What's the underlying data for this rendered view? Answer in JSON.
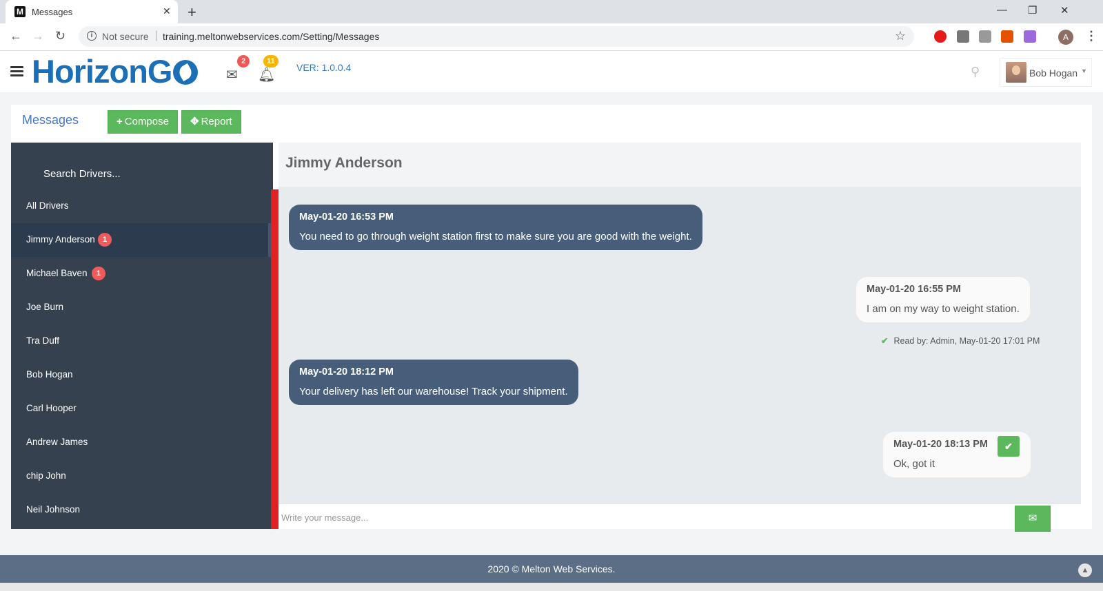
{
  "browser": {
    "tab_title": "Messages",
    "tab_favicon": "M",
    "url_security": "Not secure",
    "url": "training.meltonwebservices.com/Setting/Messages",
    "profile_initial": "A"
  },
  "header": {
    "logo_text": "HorizonG",
    "mail_count": "2",
    "bell_count": "11",
    "version": "VER: 1.0.0.4",
    "user_name": "Bob Hogan"
  },
  "portlet": {
    "title": "Messages",
    "compose_label": "Compose",
    "report_label": "Report"
  },
  "drivers": {
    "search_placeholder": "Search Drivers...",
    "items": [
      {
        "name": "All Drivers",
        "badge": ""
      },
      {
        "name": "Jimmy Anderson",
        "badge": "1"
      },
      {
        "name": "Michael Baven",
        "badge": "1"
      },
      {
        "name": "Joe Burn",
        "badge": ""
      },
      {
        "name": "Tra Duff",
        "badge": ""
      },
      {
        "name": "Bob Hogan",
        "badge": ""
      },
      {
        "name": "Carl Hooper",
        "badge": ""
      },
      {
        "name": "Andrew James",
        "badge": ""
      },
      {
        "name": "chip John",
        "badge": ""
      },
      {
        "name": "Neil Johnson",
        "badge": ""
      }
    ]
  },
  "chat": {
    "contact_name": "Jimmy Anderson",
    "messages": [
      {
        "time": "May-01-20 16:53 PM",
        "text": "You need to go through weight station first to make sure you are good with the weight."
      },
      {
        "time": "May-01-20 16:55 PM",
        "text": "I am on my way to weight station.",
        "read_by": "Read by: Admin, May-01-20 17:01 PM"
      },
      {
        "time": "May-01-20 18:12 PM",
        "text": "Your delivery has left our warehouse! Track your shipment."
      },
      {
        "time": "May-01-20 18:13 PM",
        "text": "Ok, got it"
      }
    ],
    "input_placeholder": "Write your message..."
  },
  "footer": {
    "text": "2020 © Melton Web Services."
  },
  "colors": {
    "brand_blue": "#1b6fb6",
    "green": "#5cb85c",
    "sidebar_dark": "#364150",
    "incoming_bubble": "#475e7a",
    "scrollbar_red": "#e02222"
  }
}
